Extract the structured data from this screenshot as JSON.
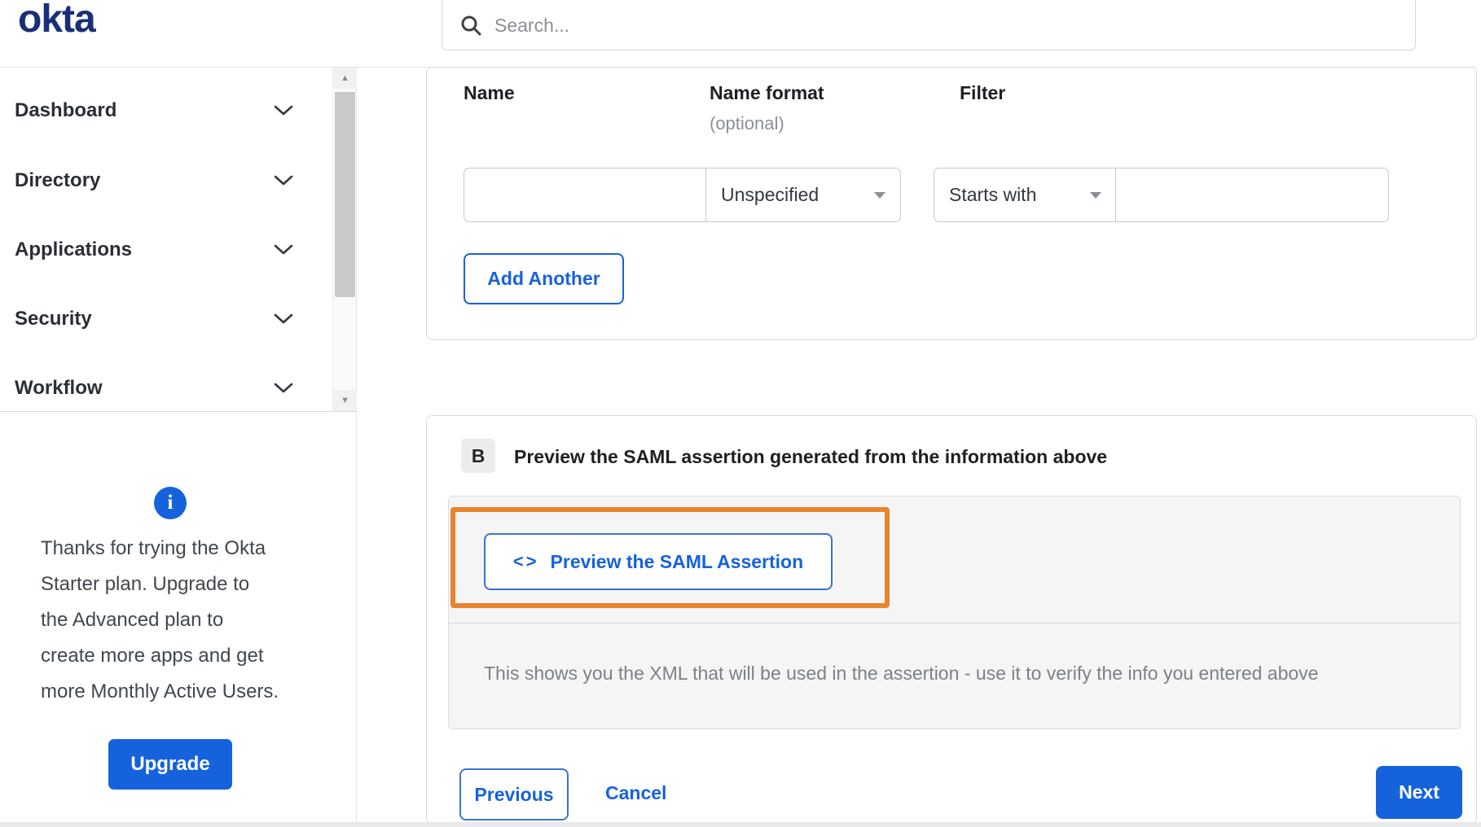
{
  "header": {
    "logo_text": "okta",
    "search_placeholder": "Search..."
  },
  "sidebar": {
    "items": [
      {
        "label": "Dashboard"
      },
      {
        "label": "Directory"
      },
      {
        "label": "Applications"
      },
      {
        "label": "Security"
      },
      {
        "label": "Workflow"
      }
    ],
    "upgrade": {
      "info_icon": "i",
      "message": "Thanks for trying the Okta\nStarter plan. Upgrade to\nthe Advanced plan to\ncreate more apps and get\nmore Monthly Active Users.",
      "button_label": "Upgrade"
    }
  },
  "form": {
    "labels": {
      "name": "Name",
      "name_format": "Name format",
      "optional": "(optional)",
      "filter": "Filter"
    },
    "name_value": "",
    "name_format_value": "Unspecified",
    "filter_operator_value": "Starts with",
    "filter_value": "",
    "add_another_label": "Add Another"
  },
  "section_b": {
    "badge": "B",
    "heading": "Preview the SAML assertion generated from the information above",
    "code_icon": "<>",
    "preview_button_label": "Preview the SAML Assertion",
    "description": "This shows you the XML that will be used in the assertion - use it to verify the info you entered above"
  },
  "footer": {
    "previous_label": "Previous",
    "cancel_label": "Cancel",
    "next_label": "Next"
  },
  "colors": {
    "primary_blue": "#1662dd",
    "logo_navy": "#1a2f7a",
    "highlight_orange": "#e8842e"
  }
}
